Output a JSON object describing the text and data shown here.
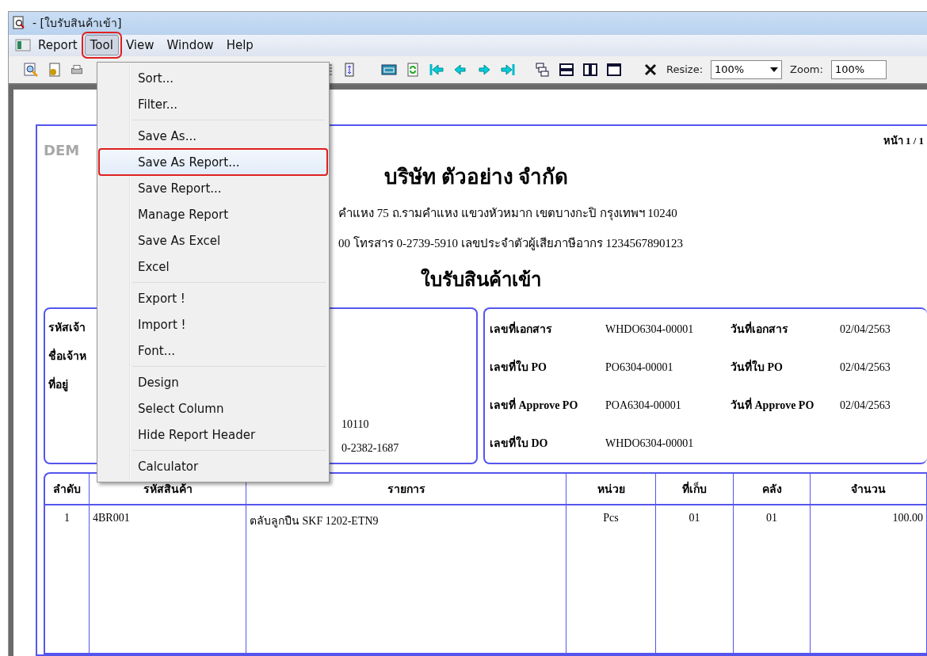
{
  "window": {
    "title": "- [ใบรับสินค้าเข้า]"
  },
  "menubar": [
    {
      "label": "Report",
      "selected": false
    },
    {
      "label": "Tool",
      "selected": true
    },
    {
      "label": "View",
      "selected": false
    },
    {
      "label": "Window",
      "selected": false
    },
    {
      "label": "Help",
      "selected": false
    }
  ],
  "menu": {
    "open": true,
    "groups": [
      [
        {
          "label": "Sort...",
          "selected": false
        },
        {
          "label": "Filter...",
          "selected": false
        }
      ],
      [
        {
          "label": "Save As...",
          "selected": false
        },
        {
          "label": "Save As Report...",
          "selected": true
        },
        {
          "label": "Save Report...",
          "selected": false
        },
        {
          "label": "Manage Report",
          "selected": false
        },
        {
          "label": "Save As Excel",
          "selected": false
        },
        {
          "label": "Excel",
          "selected": false
        }
      ],
      [
        {
          "label": "Export !",
          "selected": false
        },
        {
          "label": "Import !",
          "selected": false
        },
        {
          "label": "Font...",
          "selected": false
        }
      ],
      [
        {
          "label": "Design",
          "selected": false
        },
        {
          "label": "Select Column",
          "selected": false
        },
        {
          "label": "Hide Report Header",
          "selected": false
        }
      ],
      [
        {
          "label": "Calculator",
          "selected": false
        }
      ]
    ]
  },
  "toolbar": {
    "resize": {
      "label": "Resize:",
      "value": "100%"
    },
    "zoom": {
      "label": "Zoom:",
      "value": "100%"
    }
  },
  "report": {
    "watermark": "DEM",
    "page": "หน้า 1 / 1",
    "company": "บริษัท ตัวอย่าง จำกัด",
    "address": "คำแหง 75 ถ.รามคำแหง แขวงหัวหมาก เขตบางกะปิ กรุงเทพฯ 10240",
    "contact": "00  โทรสาร 0-2739-5910  เลขประจำตัวผู้เสียภาษีอากร 1234567890123",
    "title": "ใบรับสินค้าเข้า",
    "supplier": {
      "labels": [
        "รหัสเจ้า",
        "ชื่อเจ้าห",
        "ที่อยู่"
      ],
      "values": [
        "10110",
        "0-2382-1687"
      ]
    },
    "document": [
      {
        "label": "เลขที่เอกสาร",
        "value": "WHDO6304-00001",
        "label2": "วันที่เอกสาร",
        "value2": "02/04/2563"
      },
      {
        "label": "เลขที่ใบ PO",
        "value": "PO6304-00001",
        "label2": "วันที่ใบ PO",
        "value2": "02/04/2563"
      },
      {
        "label": "เลขที่ Approve PO",
        "value": "POA6304-00001",
        "label2": "วันที่ Approve PO",
        "value2": "02/04/2563"
      },
      {
        "label": "เลขที่ใบ DO",
        "value": "WHDO6304-00001"
      }
    ],
    "table": {
      "columns": [
        "ลำดับ",
        "รหัสสินค้า",
        "รายการ",
        "หน่วย",
        "ที่เก็บ",
        "คลัง",
        "จำนวน"
      ],
      "rows": [
        [
          "1",
          "4BR001",
          "ตลับลูกปืน SKF 1202-ETN9",
          "Pcs",
          "01",
          "01",
          "100.00"
        ]
      ]
    }
  }
}
